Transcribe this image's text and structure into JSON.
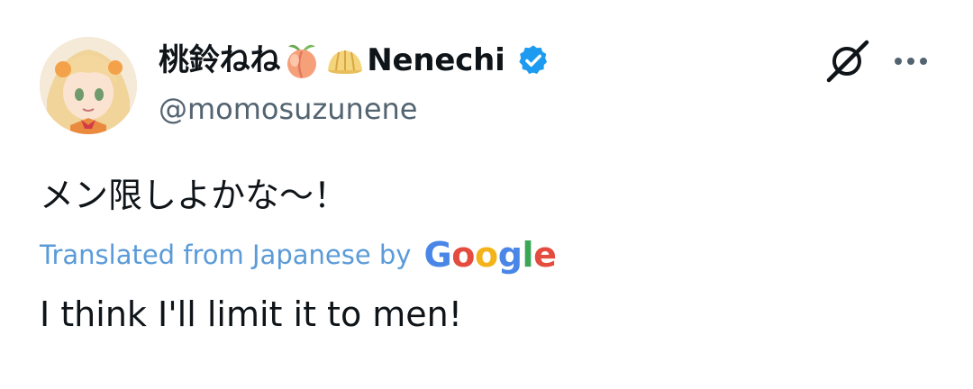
{
  "author": {
    "display_name": "桃鈴ねね",
    "display_name_suffix": "Nenechi",
    "handle": "@momosuzunene",
    "verified": true,
    "emojis": [
      "peach-icon",
      "steamed-bun-icon"
    ]
  },
  "tweet": {
    "text": "メン限しよかな〜！"
  },
  "translation": {
    "label": "Translated from Japanese by",
    "provider_logo_letters": [
      "G",
      "o",
      "o",
      "g",
      "l",
      "e"
    ],
    "text": "I think I'll limit it to men!"
  },
  "icons": {
    "grok": "grok-icon",
    "more": "more-options-icon",
    "verified": "verified-badge-icon"
  },
  "colors": {
    "text_primary": "#0f1419",
    "text_secondary": "#536471",
    "verified_blue": "#1d9bf0",
    "translation_link": "#5a9bd8",
    "google_blue": "#4a86e8",
    "google_red": "#e34c3f",
    "google_yellow": "#f3b41b",
    "google_green": "#3aa757"
  }
}
